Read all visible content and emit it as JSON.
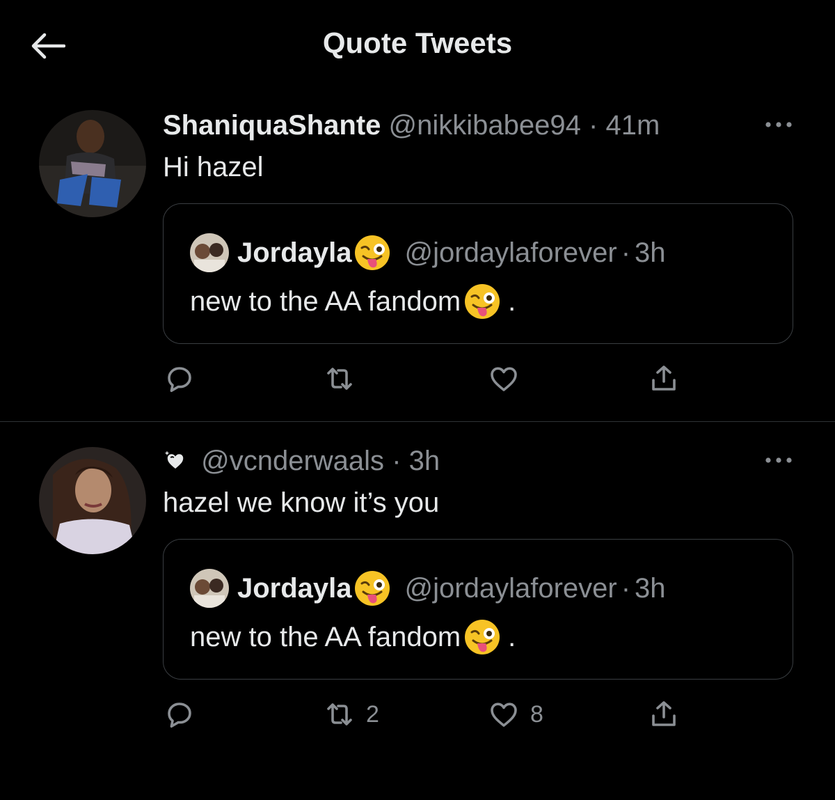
{
  "header": {
    "title": "Quote Tweets",
    "back_icon": "arrow-left-icon"
  },
  "colors": {
    "background": "#000000",
    "primary_text": "#e7e9ea",
    "secondary_text": "#8b8f94",
    "border": "#3a3e42"
  },
  "tweets": [
    {
      "display_name": "ShaniquaShante",
      "handle": "@nikkibabee94",
      "separator": "·",
      "time": "41m",
      "text": "Hi hazel",
      "quote": {
        "display_name": "Jordayla",
        "handle": "@jordaylaforever",
        "separator": "·",
        "time": "3h",
        "text": "new to the AA fandom",
        "text_suffix": "."
      },
      "actions": {
        "reply_count": "",
        "retweet_count": "",
        "like_count": ""
      }
    },
    {
      "display_name": "",
      "name_icon": "heart-sparkle-icon",
      "handle": "@vcnderwaals",
      "separator": "·",
      "time": "3h",
      "text": "hazel we know it’s you",
      "quote": {
        "display_name": "Jordayla",
        "handle": "@jordaylaforever",
        "separator": "·",
        "time": "3h",
        "text": "new to the AA fandom",
        "text_suffix": "."
      },
      "actions": {
        "reply_count": "",
        "retweet_count": "2",
        "like_count": "8"
      }
    }
  ]
}
